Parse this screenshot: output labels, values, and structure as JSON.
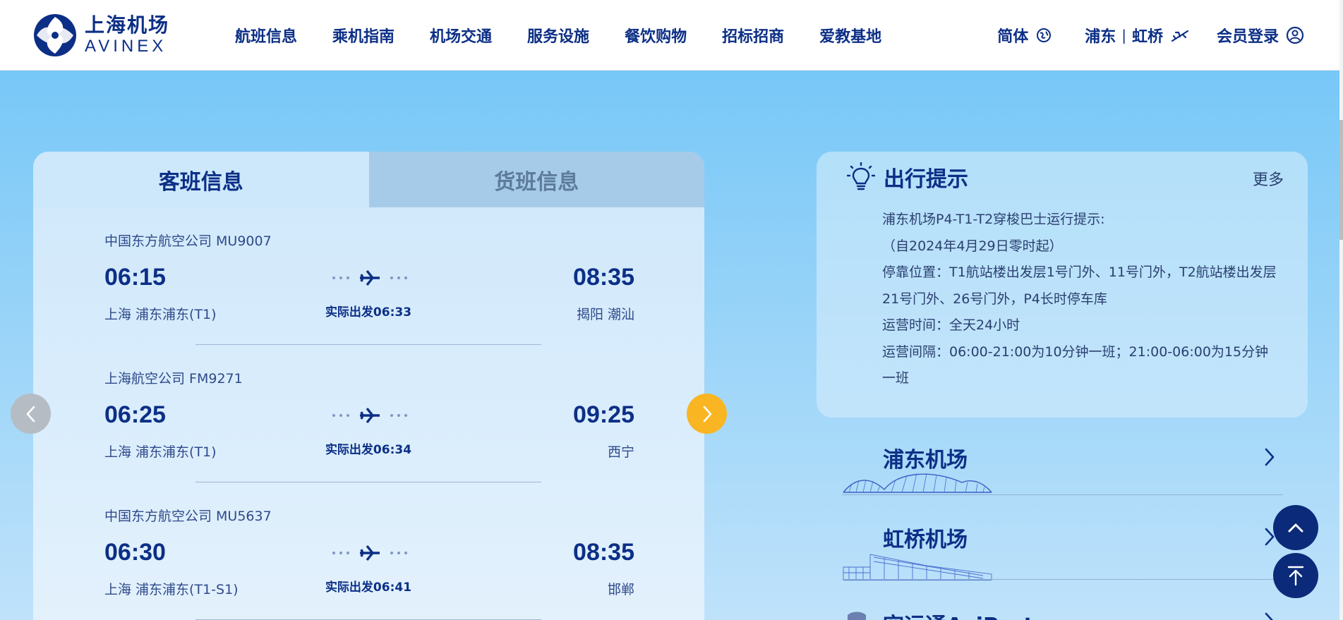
{
  "header": {
    "logo": {
      "cn": "上海机场",
      "en": "AVINEX"
    },
    "nav": [
      "航班信息",
      "乘机指南",
      "机场交通",
      "服务设施",
      "餐饮购物",
      "招标招商",
      "爱教基地"
    ],
    "lang": "简体",
    "airport_switch": {
      "pudong": "浦东",
      "sep": "|",
      "hongqiao": "虹桥"
    },
    "login": "会员登录"
  },
  "flights": {
    "tabs": [
      "客班信息",
      "货班信息"
    ],
    "active_tab": 0,
    "items": [
      {
        "airline": "中国东方航空公司 MU9007",
        "dep_time": "06:15",
        "dep_place": "上海 浦东浦东(T1)",
        "status": "实际出发06:33",
        "arr_time": "08:35",
        "arr_place": "揭阳 潮汕"
      },
      {
        "airline": "上海航空公司 FM9271",
        "dep_time": "06:25",
        "dep_place": "上海 浦东浦东(T1)",
        "status": "实际出发06:34",
        "arr_time": "09:25",
        "arr_place": "西宁"
      },
      {
        "airline": "中国东方航空公司 MU5637",
        "dep_time": "06:30",
        "dep_place": "上海 浦东浦东(T1-S1)",
        "status": "实际出发06:41",
        "arr_time": "08:35",
        "arr_place": "邯郸"
      }
    ]
  },
  "tips": {
    "title": "出行提示",
    "more": "更多",
    "lines": [
      "浦东机场P4-T1-T2穿梭巴士运行提示:",
      "（自2024年4月29日零时起）",
      "停靠位置：T1航站楼出发层1号门外、11号门外，T2航站楼出发层21号门外、26号门外，P4长时停车库",
      "运营时间：全天24小时",
      "运营间隔：06:00-21:00为10分钟一班；21:00-06:00为15分钟一班"
    ]
  },
  "airports": [
    {
      "name": "浦东机场"
    },
    {
      "name": "虹桥机场"
    },
    {
      "name": "空运通AviPort"
    }
  ],
  "colors": {
    "primary": "#0c2f86",
    "accent": "#f9b522",
    "background": "#6ec4f7"
  },
  "icons": {
    "lang": "globe-icon",
    "switch": "plane-icon",
    "login": "user-icon",
    "tips": "lightbulb-icon"
  }
}
